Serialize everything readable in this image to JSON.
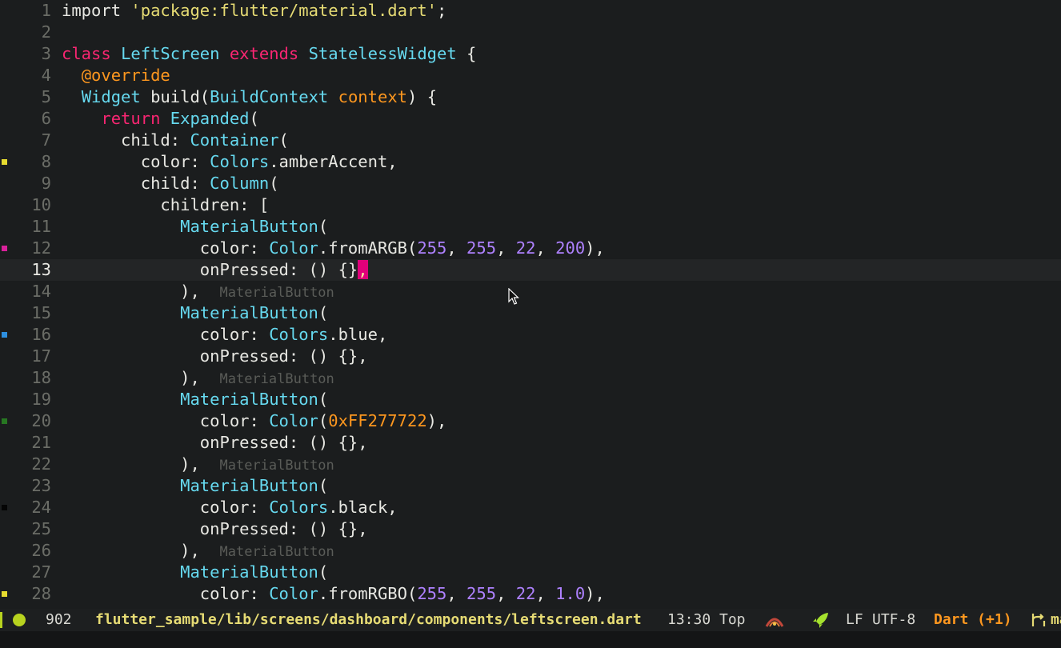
{
  "editor": {
    "current_line": 13,
    "lines": [
      {
        "n": "1",
        "tokens": [
          [
            "p",
            "import "
          ],
          [
            "str",
            "'package:flutter/material.dart'"
          ],
          [
            "p",
            ";"
          ]
        ]
      },
      {
        "n": "2",
        "tokens": []
      },
      {
        "n": "3",
        "tokens": [
          [
            "kw",
            "class "
          ],
          [
            "ty",
            "LeftScreen "
          ],
          [
            "kw",
            "extends "
          ],
          [
            "ty",
            "StatelessWidget"
          ],
          [
            "p",
            " {"
          ]
        ]
      },
      {
        "n": "4",
        "tokens": [
          [
            "p",
            "  "
          ],
          [
            "ann",
            "@override"
          ]
        ]
      },
      {
        "n": "5",
        "tokens": [
          [
            "p",
            "  "
          ],
          [
            "ty",
            "Widget "
          ],
          [
            "p",
            "build("
          ],
          [
            "ty",
            "BuildContext "
          ],
          [
            "param",
            "context"
          ],
          [
            "p",
            ") {"
          ]
        ]
      },
      {
        "n": "6",
        "tokens": [
          [
            "p",
            "    "
          ],
          [
            "kw",
            "return "
          ],
          [
            "ty",
            "Expanded"
          ],
          [
            "p",
            "("
          ]
        ]
      },
      {
        "n": "7",
        "tokens": [
          [
            "p",
            "      child: "
          ],
          [
            "ty",
            "Container"
          ],
          [
            "p",
            "("
          ]
        ]
      },
      {
        "n": "8",
        "mark": "#e6db2f",
        "tokens": [
          [
            "p",
            "        color: "
          ],
          [
            "ty",
            "Colors"
          ],
          [
            "p",
            ".amberAccent,"
          ]
        ]
      },
      {
        "n": "9",
        "tokens": [
          [
            "p",
            "        child: "
          ],
          [
            "ty",
            "Column"
          ],
          [
            "p",
            "("
          ]
        ]
      },
      {
        "n": "10",
        "tokens": [
          [
            "p",
            "          children: ["
          ]
        ]
      },
      {
        "n": "11",
        "tokens": [
          [
            "p",
            "            "
          ],
          [
            "ty",
            "MaterialButton"
          ],
          [
            "p",
            "("
          ]
        ]
      },
      {
        "n": "12",
        "mark": "#d8219a",
        "tokens": [
          [
            "p",
            "              color: "
          ],
          [
            "ty",
            "Color"
          ],
          [
            "p",
            ".fromARGB("
          ],
          [
            "num",
            "255"
          ],
          [
            "p",
            ", "
          ],
          [
            "num",
            "255"
          ],
          [
            "p",
            ", "
          ],
          [
            "num",
            "22"
          ],
          [
            "p",
            ", "
          ],
          [
            "num",
            "200"
          ],
          [
            "p",
            "),"
          ]
        ]
      },
      {
        "n": "13",
        "current": true,
        "tokens": [
          [
            "p",
            "              onPressed: () {}"
          ],
          [
            "cursor",
            ","
          ]
        ]
      },
      {
        "n": "14",
        "tokens": [
          [
            "p",
            "            ),  "
          ],
          [
            "hint",
            "MaterialButton"
          ]
        ]
      },
      {
        "n": "15",
        "tokens": [
          [
            "p",
            "            "
          ],
          [
            "ty",
            "MaterialButton"
          ],
          [
            "p",
            "("
          ]
        ]
      },
      {
        "n": "16",
        "mark": "#2d8fe0",
        "tokens": [
          [
            "p",
            "              color: "
          ],
          [
            "ty",
            "Colors"
          ],
          [
            "p",
            ".blue,"
          ]
        ]
      },
      {
        "n": "17",
        "tokens": [
          [
            "p",
            "              onPressed: () {},"
          ]
        ]
      },
      {
        "n": "18",
        "tokens": [
          [
            "p",
            "            ),  "
          ],
          [
            "hint",
            "MaterialButton"
          ]
        ]
      },
      {
        "n": "19",
        "tokens": [
          [
            "p",
            "            "
          ],
          [
            "ty",
            "MaterialButton"
          ],
          [
            "p",
            "("
          ]
        ]
      },
      {
        "n": "20",
        "mark": "#277722",
        "tokens": [
          [
            "p",
            "              color: "
          ],
          [
            "ty",
            "Color"
          ],
          [
            "p",
            "("
          ],
          [
            "hex",
            "0xFF277722"
          ],
          [
            "p",
            "),"
          ]
        ]
      },
      {
        "n": "21",
        "tokens": [
          [
            "p",
            "              onPressed: () {},"
          ]
        ]
      },
      {
        "n": "22",
        "tokens": [
          [
            "p",
            "            ),  "
          ],
          [
            "hint",
            "MaterialButton"
          ]
        ]
      },
      {
        "n": "23",
        "tokens": [
          [
            "p",
            "            "
          ],
          [
            "ty",
            "MaterialButton"
          ],
          [
            "p",
            "("
          ]
        ]
      },
      {
        "n": "24",
        "mark": "#050505",
        "tokens": [
          [
            "p",
            "              color: "
          ],
          [
            "ty",
            "Colors"
          ],
          [
            "p",
            ".black,"
          ]
        ]
      },
      {
        "n": "25",
        "tokens": [
          [
            "p",
            "              onPressed: () {},"
          ]
        ]
      },
      {
        "n": "26",
        "tokens": [
          [
            "p",
            "            ),  "
          ],
          [
            "hint",
            "MaterialButton"
          ]
        ]
      },
      {
        "n": "27",
        "tokens": [
          [
            "p",
            "            "
          ],
          [
            "ty",
            "MaterialButton"
          ],
          [
            "p",
            "("
          ]
        ]
      },
      {
        "n": "28",
        "mark": "#e6db2f",
        "tokens": [
          [
            "p",
            "              color: "
          ],
          [
            "ty",
            "Color"
          ],
          [
            "p",
            ".fromRGBO("
          ],
          [
            "num",
            "255"
          ],
          [
            "p",
            ", "
          ],
          [
            "num",
            "255"
          ],
          [
            "p",
            ", "
          ],
          [
            "num",
            "22"
          ],
          [
            "p",
            ", "
          ],
          [
            "num",
            "1.0"
          ],
          [
            "p",
            "),"
          ]
        ]
      }
    ]
  },
  "statusbar": {
    "buffer_size": "902",
    "file_path": "flutter_sample/lib/screens/dashboard/components/leftscreen.dart",
    "position": "13:30",
    "scroll": "Top",
    "line_ending": "LF",
    "encoding": "UTF-8",
    "major_mode": "Dart (+1)",
    "branch_fragment": "ma",
    "accent_color": "#b8d31f",
    "mode_color": "#fd971f",
    "icons": [
      "status-dot-icon",
      "nyan-icon",
      "rocket-icon",
      "git-branch-icon"
    ]
  }
}
